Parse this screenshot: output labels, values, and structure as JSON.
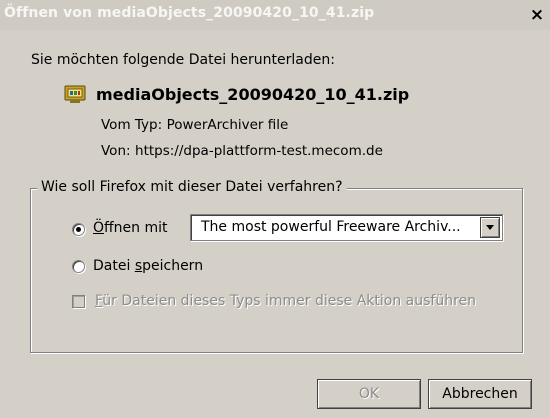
{
  "window": {
    "title": "Öffnen von mediaObjects_20090420_10_41.zip",
    "close_label": "×"
  },
  "intro_text": "Sie möchten folgende Datei herunterladen:",
  "file": {
    "name": "mediaObjects_20090420_10_41.zip",
    "icon": "powerarchiver-file-icon",
    "type_label": "Vom Typ:",
    "type_value": "PowerArchiver file",
    "from_label": "Von:",
    "from_value": "https://dpa-plattform-test.mecom.de"
  },
  "action_group": {
    "legend": "Wie soll Firefox mit dieser Datei verfahren?",
    "open_with": {
      "label_mnemonic": "Ö",
      "label_rest": "ffnen mit",
      "selected": true,
      "app_value": "The most powerful Freeware Archiv..."
    },
    "save_file": {
      "label_start": "Datei ",
      "label_mnemonic": "s",
      "label_rest": "peichern",
      "selected": false
    },
    "always_do": {
      "label_mnemonic": "F",
      "label_rest": "ür Dateien dieses Typs immer diese Aktion ausführen",
      "checked": false,
      "disabled": true
    }
  },
  "buttons": {
    "ok_label": "OK",
    "cancel_label": "Abbrechen"
  },
  "colors": {
    "dialog_bg": "#d4d0c8",
    "titlebar_bg": "#cfcbc3",
    "title_text": "#f7f6f3",
    "disabled_text": "#8c8c8c"
  }
}
